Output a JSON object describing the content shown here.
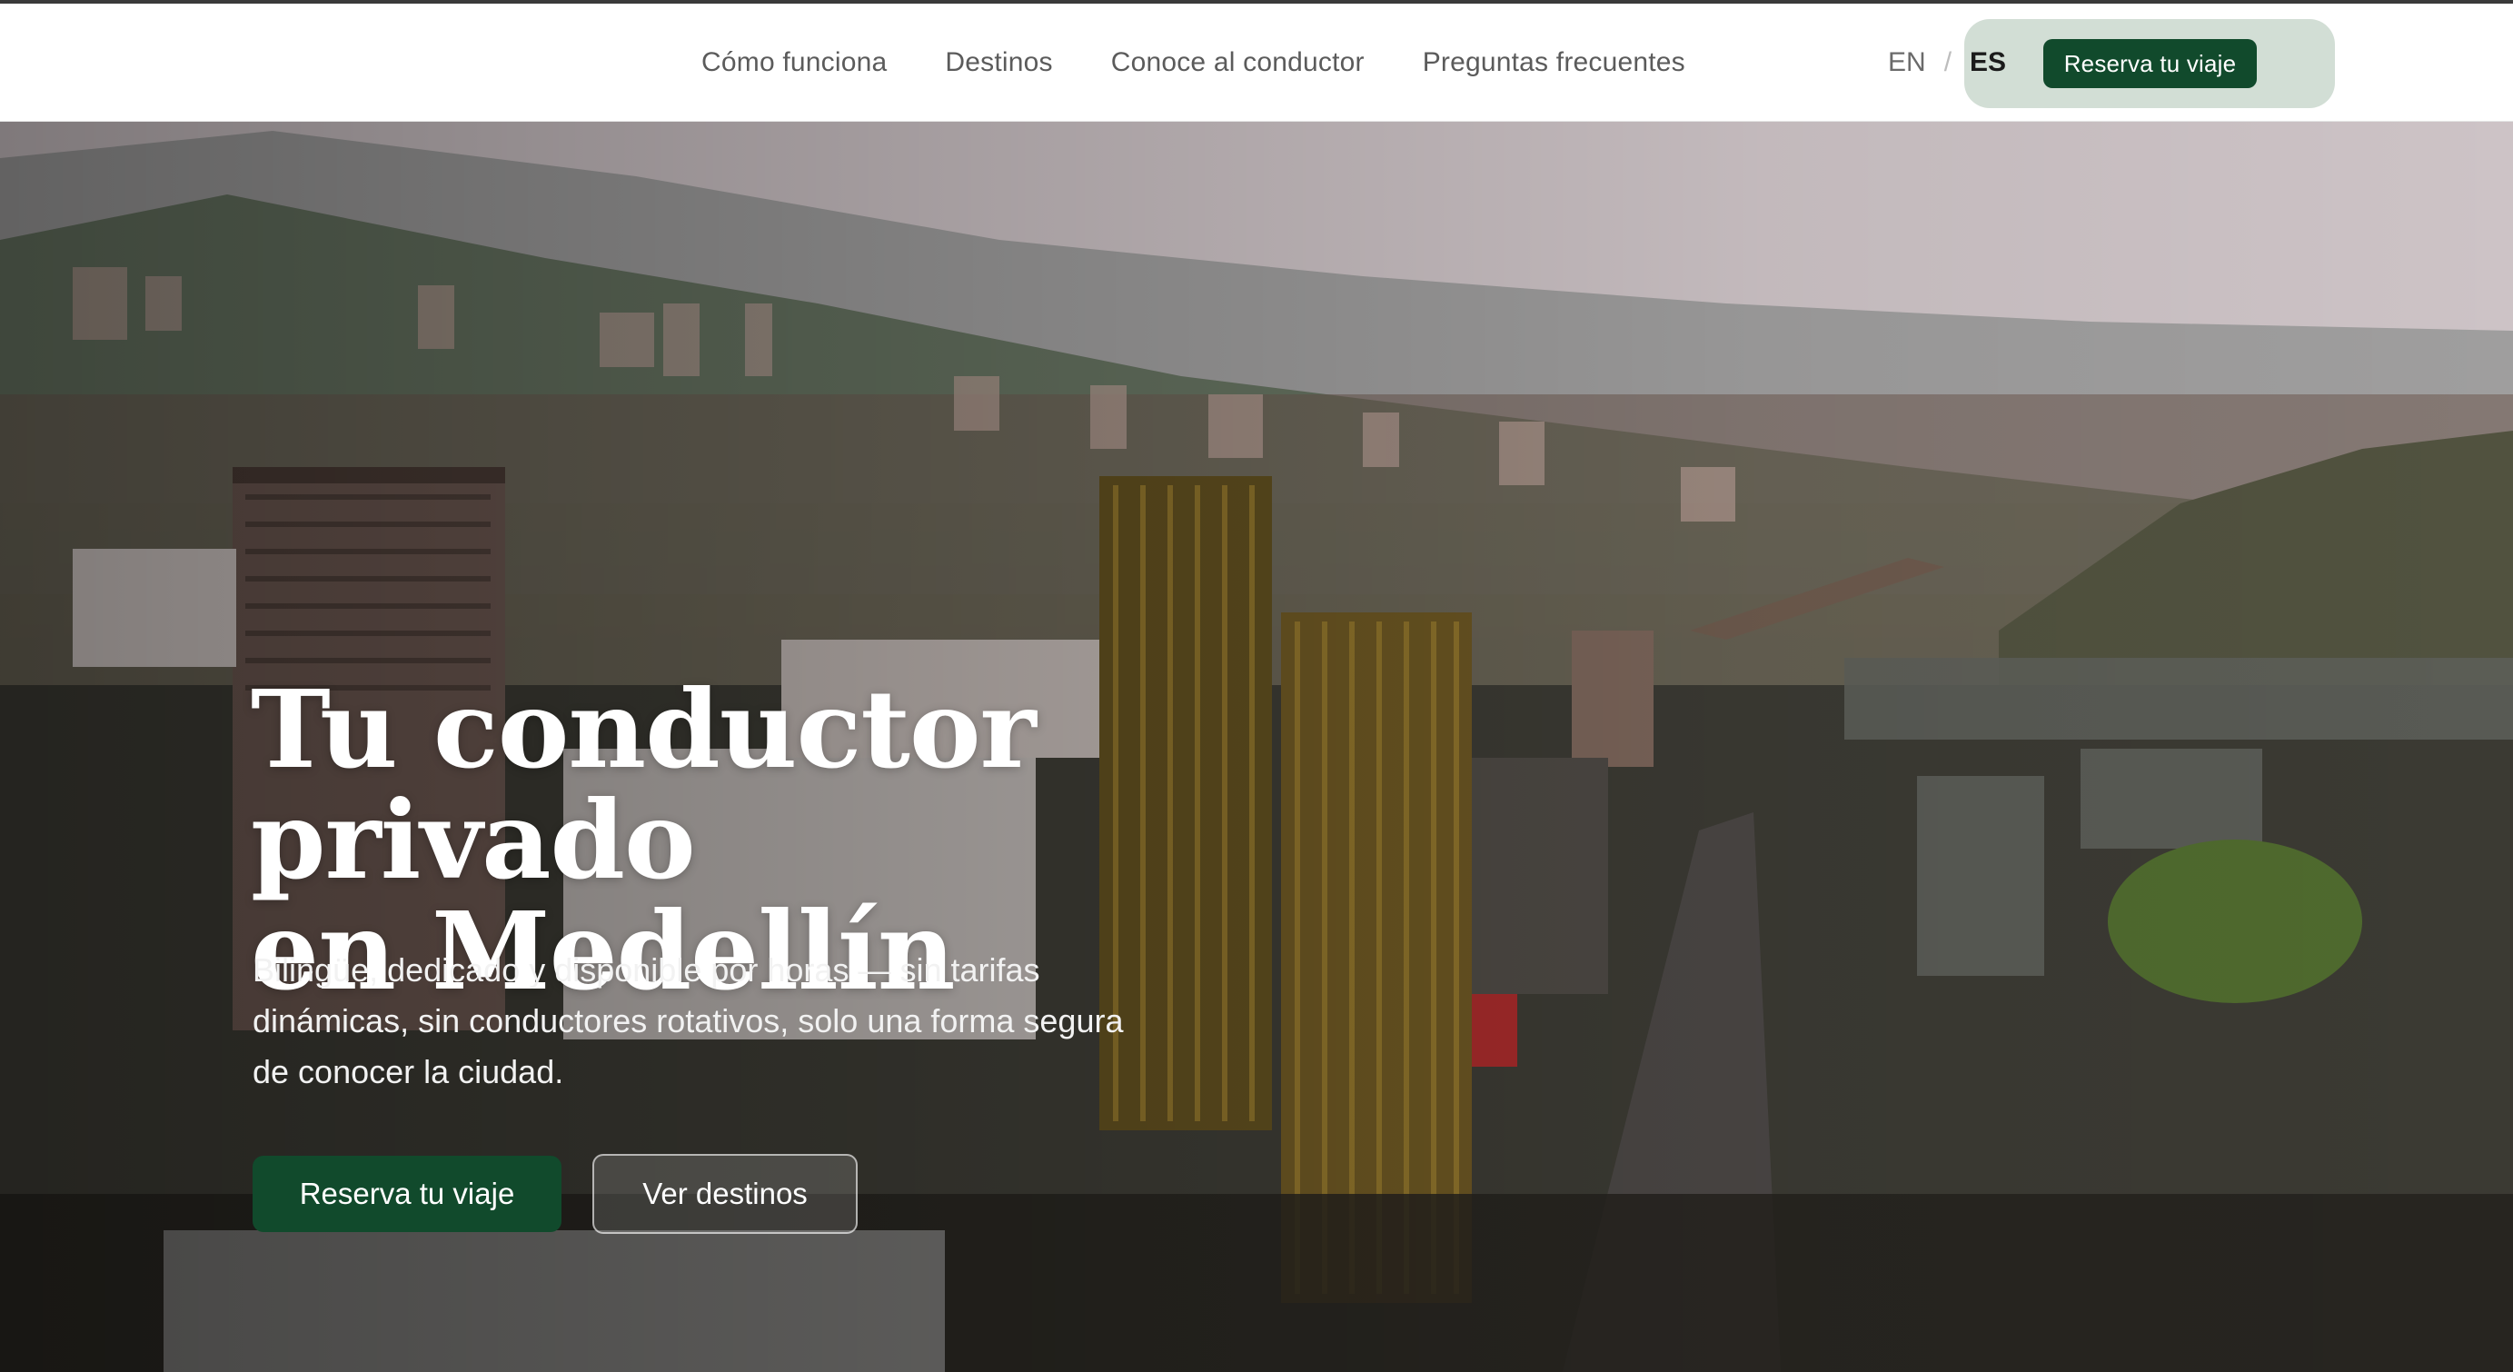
{
  "nav": {
    "links": [
      "Cómo funciona",
      "Destinos",
      "Conoce al conductor",
      "Preguntas frecuentes"
    ],
    "lang": {
      "en": "EN",
      "separator": "/",
      "es": "ES",
      "active": "ES"
    },
    "cta_label": "Reserva tu viaje"
  },
  "hero": {
    "title_line1": "Tu conductor privado",
    "title_line2": "en Medellín",
    "subtitle": "Bilingüe, dedicado y disponible por horas — sin tarifas dinámicas, sin conductores rotativos, solo una forma segura de conocer la ciudad.",
    "primary_button": "Reserva tu viaje",
    "secondary_button": "Ver destinos"
  },
  "colors": {
    "brand_green": "#114a2c",
    "pill_background": "#d2ded5",
    "nav_text": "#5b5b5b"
  }
}
